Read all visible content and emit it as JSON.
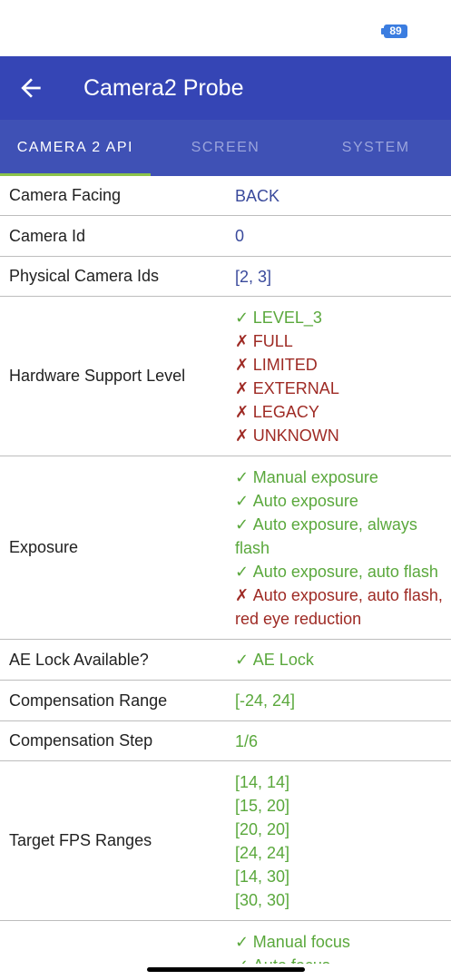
{
  "status_bar": {
    "battery": "89"
  },
  "app_bar": {
    "title": "Camera2 Probe"
  },
  "tabs": [
    {
      "label": "CAMERA 2 API",
      "active": true
    },
    {
      "label": "SCREEN",
      "active": false
    },
    {
      "label": "SYSTEM",
      "active": false
    }
  ],
  "colors": {
    "app_bar": "#3545b5",
    "tab_bar": "#3f51b5",
    "tab_indicator": "#8bc34a",
    "supported": "#5aa83c",
    "unsupported": "#9e2a24",
    "plain_value": "#3a4a9c"
  },
  "icons": {
    "supported": "checkmark-icon",
    "unsupported": "cross-icon",
    "back": "back-arrow-icon"
  },
  "rows": [
    {
      "label": "Camera Facing",
      "values": [
        {
          "text": "BACK",
          "status": "plain"
        }
      ]
    },
    {
      "label": "Camera Id",
      "values": [
        {
          "text": "0",
          "status": "plain"
        }
      ]
    },
    {
      "label": "Physical Camera Ids",
      "values": [
        {
          "text": "[2, 3]",
          "status": "plain"
        }
      ]
    },
    {
      "label": "Hardware Support Level",
      "values": [
        {
          "text": "LEVEL_3",
          "status": "yes"
        },
        {
          "text": "FULL",
          "status": "no"
        },
        {
          "text": "LIMITED",
          "status": "no"
        },
        {
          "text": "EXTERNAL",
          "status": "no"
        },
        {
          "text": "LEGACY",
          "status": "no"
        },
        {
          "text": "UNKNOWN",
          "status": "no"
        }
      ]
    },
    {
      "label": "Exposure",
      "values": [
        {
          "text": "Manual exposure",
          "status": "yes"
        },
        {
          "text": "Auto exposure",
          "status": "yes"
        },
        {
          "text": "Auto exposure, always flash",
          "status": "yes"
        },
        {
          "text": "Auto exposure, auto flash",
          "status": "yes"
        },
        {
          "text": "Auto exposure, auto flash, red eye reduction",
          "status": "no"
        }
      ]
    },
    {
      "label": "AE Lock Available?",
      "values": [
        {
          "text": "AE Lock",
          "status": "yes"
        }
      ]
    },
    {
      "label": "Compensation Range",
      "values": [
        {
          "text": "[-24, 24]",
          "status": "green"
        }
      ]
    },
    {
      "label": "Compensation Step",
      "values": [
        {
          "text": "1/6",
          "status": "green"
        }
      ]
    },
    {
      "label": "Target FPS Ranges",
      "values": [
        {
          "text": "[14, 14]",
          "status": "green"
        },
        {
          "text": "[15, 20]",
          "status": "green"
        },
        {
          "text": "[20, 20]",
          "status": "green"
        },
        {
          "text": "[24, 24]",
          "status": "green"
        },
        {
          "text": "[14, 30]",
          "status": "green"
        },
        {
          "text": "[30, 30]",
          "status": "green"
        }
      ]
    },
    {
      "label": "",
      "values": [
        {
          "text": "Manual focus",
          "status": "yes"
        },
        {
          "text": "Auto focus",
          "status": "yes"
        }
      ]
    }
  ]
}
